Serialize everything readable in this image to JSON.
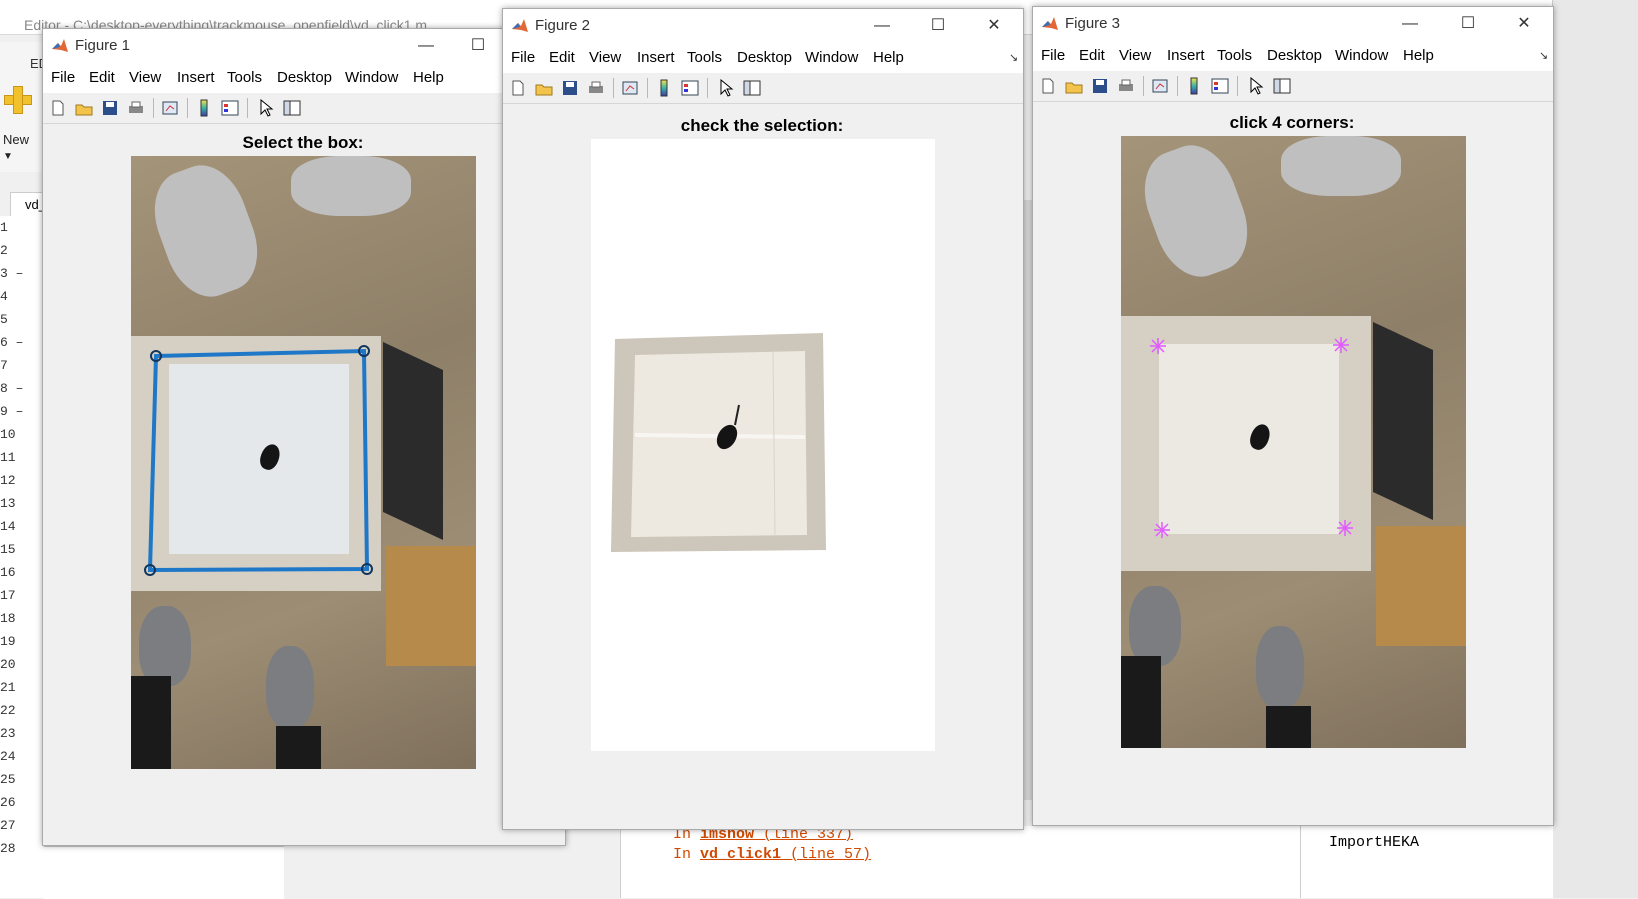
{
  "background": {
    "editor_title": "Editor - C:\\desktop-everything\\trackmouse_openfield\\vd_click1.m",
    "tab_label": "ED",
    "new_label": "New",
    "doc_tab": "vd_",
    "line_numbers": [
      "1",
      "2",
      "3 –",
      "4",
      "5",
      "6 –",
      "7",
      "8 –",
      "9 –",
      "10",
      "11",
      "12",
      "13",
      "14",
      "15",
      "16",
      "17",
      "18",
      "19",
      "20",
      "21",
      "22",
      "23",
      "24",
      "25",
      "26",
      "27",
      "28"
    ],
    "cmd_lines": [
      {
        "prefix": "In ",
        "fn": "imshow",
        "rest": " (line 337)"
      },
      {
        "prefix": "In ",
        "fn": "vd_click1",
        "rest": " (line 57)"
      }
    ],
    "workspace_item": "ImportHEKA"
  },
  "menus": [
    "File",
    "Edit",
    "View",
    "Insert",
    "Tools",
    "Desktop",
    "Window",
    "Help"
  ],
  "figure1": {
    "title": "Figure 1",
    "axis_title": "Select the box:"
  },
  "figure2": {
    "title": "Figure 2",
    "axis_title": "check the selection:"
  },
  "figure3": {
    "title": "Figure 3",
    "axis_title": "click 4 corners:"
  },
  "window_buttons": {
    "minimize": "—",
    "maximize": "☐",
    "close": "✕"
  },
  "colors": {
    "selection_box": "#1f77c8",
    "corner_markers": "#e05aff"
  }
}
